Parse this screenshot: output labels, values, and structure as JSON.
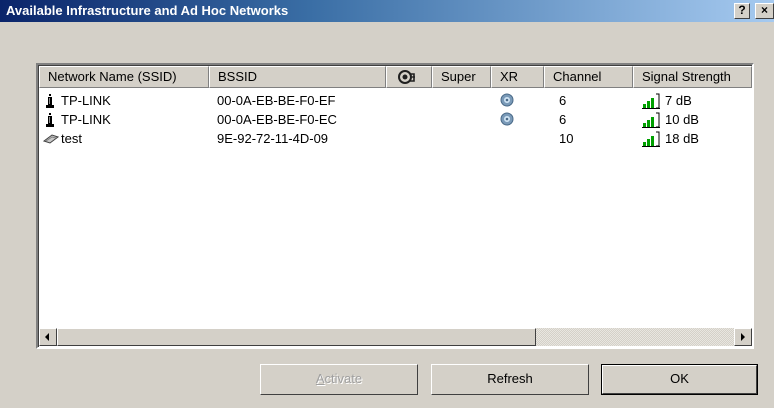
{
  "window": {
    "title": "Available Infrastructure and Ad Hoc Networks",
    "help_label": "?",
    "close_label": "×"
  },
  "columns": [
    {
      "label": "Network Name (SSID)"
    },
    {
      "label": "BSSID"
    },
    {
      "label": "",
      "icon": "wep-key-icon"
    },
    {
      "label": "Super"
    },
    {
      "label": "XR"
    },
    {
      "label": "Channel"
    },
    {
      "label": "Signal Strength"
    }
  ],
  "rows": [
    {
      "type": "infrastructure",
      "icon": "access-point-icon",
      "ssid": "TP-LINK",
      "bssid": "00-0A-EB-BE-F0-EF",
      "xr": true,
      "channel": "6",
      "signal": "7 dB"
    },
    {
      "type": "infrastructure",
      "icon": "access-point-icon",
      "ssid": "TP-LINK",
      "bssid": "00-0A-EB-BE-F0-EC",
      "xr": true,
      "channel": "6",
      "signal": "10 dB"
    },
    {
      "type": "adhoc",
      "icon": "adhoc-network-icon",
      "ssid": "test",
      "bssid": "9E-92-72-11-4D-09",
      "xr": false,
      "channel": "10",
      "signal": "18 dB"
    }
  ],
  "buttons": {
    "activate_prefix": "",
    "activate_accel": "A",
    "activate_rest": "ctivate",
    "refresh": "Refresh",
    "ok": "OK"
  },
  "colors": {
    "title_start": "#0a246a",
    "signal_green": "#00a000",
    "face": "#d4d0c8"
  }
}
